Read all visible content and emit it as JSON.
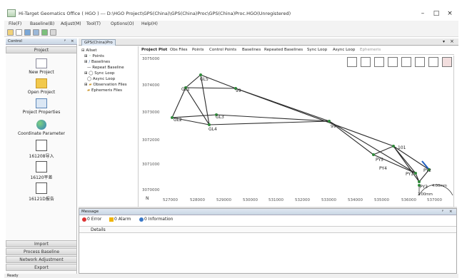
{
  "window": {
    "title": "Hi-Target Geomatics Office ( HGO ) --- D:\\HGO Project\\GPS(China)\\GPS(China)Proc\\GPS(China)Proc.HGO(Unregistered)"
  },
  "menu": [
    "File(F)",
    "Baseline(B)",
    "Adjust(M)",
    "Tool(T)",
    "Options(O)",
    "Help(H)"
  ],
  "left_panel": {
    "title": "Control",
    "sections": {
      "top": "Project",
      "bottom": [
        "Import",
        "Process Baseline",
        "Network Adjustment",
        "Export"
      ]
    },
    "items": [
      "New Project",
      "Open Project",
      "Project Properties",
      "Coordinate Parameter",
      "161208导入",
      "16120平差",
      "16121D报告"
    ]
  },
  "document_tab": "GPS(China)Pro",
  "tree": {
    "root": "Allset",
    "items": [
      "Points",
      "Baselines",
      "Repeat Baseline",
      "Sync Loop",
      "Async Loop",
      "Observation Files",
      "Ephemeris Files"
    ]
  },
  "tabs": [
    "Project Plot",
    "Obs Files",
    "Points",
    "Control Points",
    "Baselines",
    "Repeated Baselines",
    "Sync Loop",
    "Async Loop",
    "Ephemeris"
  ],
  "plot": {
    "y_labels": [
      "3074000",
      "3073000",
      "3072000",
      "3071000",
      "3070000"
    ],
    "y_top_partial": "3075000",
    "x_labels": [
      "527000",
      "528000",
      "529000",
      "530000",
      "531000",
      "532000",
      "533000",
      "534000",
      "535000",
      "536000",
      "537000"
    ],
    "points": {
      "GL1": "GL1",
      "GL5": "GL5",
      "99a": "99",
      "GL2": "GL2",
      "GL3": "GL3",
      "GL4": "GL4",
      "99b": "99",
      "101": "101",
      "PY5": "PY5",
      "PY4": "PY4",
      "PY1": "PY1",
      "PY2": "PY2",
      "PY3": "PY3"
    },
    "scale_bar": "4.00mm",
    "scale_bar2": "2.00mm",
    "north": "N"
  },
  "messages": {
    "title": "Message",
    "filters": [
      "0 Error",
      "0 Alarm",
      "0 Information"
    ],
    "column": "Details"
  },
  "status": "Ready"
}
